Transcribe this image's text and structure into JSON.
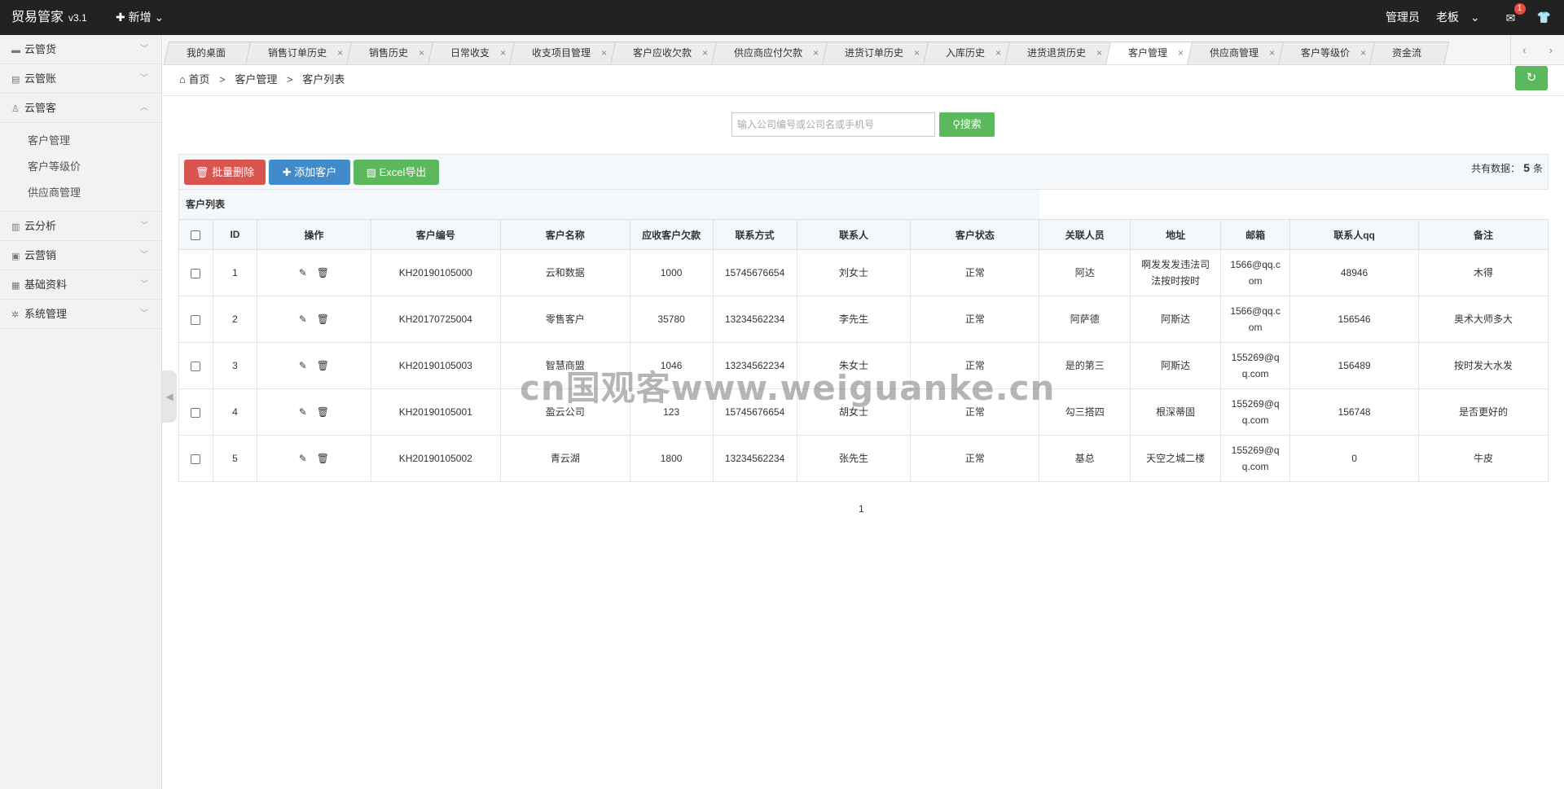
{
  "header": {
    "app_name": "贸易管家",
    "version": "v3.1",
    "add_new": "新增",
    "role": "管理员",
    "user": "老板",
    "mail_count": "1"
  },
  "sidebar": {
    "items": [
      {
        "label": "云管货",
        "icon": "truck-icon"
      },
      {
        "label": "云管账",
        "icon": "ledger-icon"
      },
      {
        "label": "云管客",
        "icon": "user-icon",
        "expanded": true,
        "subitems": [
          "客户管理",
          "客户等级价",
          "供应商管理"
        ]
      },
      {
        "label": "云分析",
        "icon": "bar-chart-icon"
      },
      {
        "label": "云营销",
        "icon": "gift-icon"
      },
      {
        "label": "基础资料",
        "icon": "database-icon"
      },
      {
        "label": "系统管理",
        "icon": "gear-icon"
      }
    ]
  },
  "tabs": [
    {
      "label": "我的桌面",
      "closable": false
    },
    {
      "label": "销售订单历史",
      "closable": true
    },
    {
      "label": "销售历史",
      "closable": true
    },
    {
      "label": "日常收支",
      "closable": true
    },
    {
      "label": "收支项目管理",
      "closable": true
    },
    {
      "label": "客户应收欠款",
      "closable": true
    },
    {
      "label": "供应商应付欠款",
      "closable": true
    },
    {
      "label": "进货订单历史",
      "closable": true
    },
    {
      "label": "入库历史",
      "closable": true
    },
    {
      "label": "进货退货历史",
      "closable": true
    },
    {
      "label": "客户管理",
      "closable": true,
      "active": true
    },
    {
      "label": "供应商管理",
      "closable": true
    },
    {
      "label": "客户等级价",
      "closable": true
    },
    {
      "label": "资金流",
      "closable": false
    }
  ],
  "breadcrumb": {
    "home": "首页",
    "level1": "客户管理",
    "level2": "客户列表",
    "sep": ">"
  },
  "search": {
    "placeholder": "输入公司编号或公司名或手机号",
    "button": "搜索"
  },
  "toolbar": {
    "batch_delete": "批量删除",
    "add_customer": "添加客户",
    "excel_export": "Excel导出",
    "total_label": "共有数据：",
    "total_count": "5",
    "total_unit": "条"
  },
  "table": {
    "caption": "客户列表",
    "columns": [
      "ID",
      "操作",
      "客户编号",
      "客户名称",
      "应收客户欠款",
      "联系方式",
      "联系人",
      "客户状态",
      "关联人员",
      "地址",
      "邮箱",
      "联系人qq",
      "备注"
    ],
    "rows": [
      {
        "id": "1",
        "code": "KH20190105000",
        "name": "云和数据",
        "debt": "1000",
        "phone": "15745676654",
        "contact": "刘女士",
        "status": "正常",
        "related": "阿达",
        "address": "啊发发发违法司法按时按时",
        "email": "1566@qq.com",
        "qq": "48946",
        "note": "木得"
      },
      {
        "id": "2",
        "code": "KH20170725004",
        "name": "零售客户",
        "debt": "35780",
        "phone": "13234562234",
        "contact": "李先生",
        "status": "正常",
        "related": "阿萨德",
        "address": "阿斯达",
        "email": "1566@qq.com",
        "qq": "156546",
        "note": "奥术大师多大"
      },
      {
        "id": "3",
        "code": "KH20190105003",
        "name": "智慧商盟",
        "debt": "1046",
        "phone": "13234562234",
        "contact": "朱女士",
        "status": "正常",
        "related": "是的第三",
        "address": "阿斯达",
        "email": "155269@qq.com",
        "qq": "156489",
        "note": "按时发大水发"
      },
      {
        "id": "4",
        "code": "KH20190105001",
        "name": "盈云公司",
        "debt": "123",
        "phone": "15745676654",
        "contact": "胡女士",
        "status": "正常",
        "related": "勾三搭四",
        "address": "根深蒂固",
        "email": "155269@qq.com",
        "qq": "156748",
        "note": "是否更好的"
      },
      {
        "id": "5",
        "code": "KH20190105002",
        "name": "青云湖",
        "debt": "1800",
        "phone": "13234562234",
        "contact": "张先生",
        "status": "正常",
        "related": "基总",
        "address": "天空之城二楼",
        "email": "155269@qq.com",
        "qq": "0",
        "note": "牛皮"
      }
    ]
  },
  "pager": {
    "current": "1"
  },
  "watermark": "cn国观客www.weiguanke.cn"
}
